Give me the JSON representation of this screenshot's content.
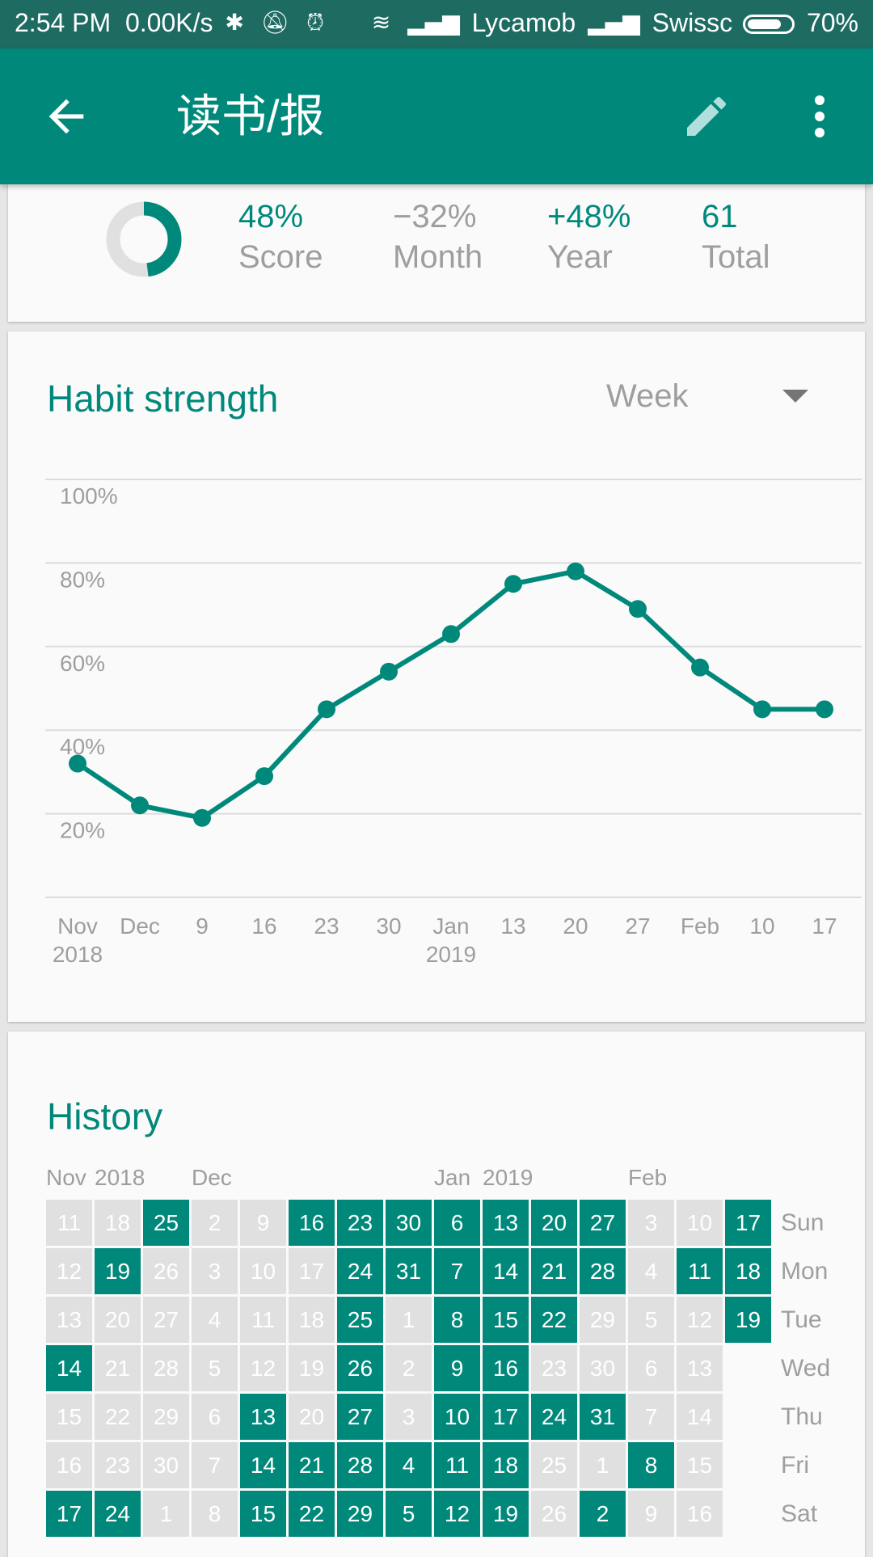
{
  "status_bar": {
    "time": "2:54 PM",
    "speed": "0.00K/s",
    "carrier1": "Lycamob",
    "carrier2": "Swissc",
    "battery": "70%"
  },
  "app_bar": {
    "title": "读书/报",
    "back_icon": "arrow-back-icon",
    "edit_icon": "pencil-icon",
    "more_icon": "more-vert-icon"
  },
  "overview": {
    "score_fraction": 0.48,
    "stats": [
      {
        "value": "48%",
        "label": "Score",
        "color": "#00897b"
      },
      {
        "value": "−32%",
        "label": "Month",
        "color": "#9e9e9e"
      },
      {
        "value": "+48%",
        "label": "Year",
        "color": "#00897b"
      },
      {
        "value": "61",
        "label": "Total",
        "color": "#00897b"
      }
    ]
  },
  "strength": {
    "title": "Habit strength",
    "period": "Week"
  },
  "chart_data": {
    "type": "line",
    "x": [
      "Nov 2018",
      "Dec",
      "9",
      "16",
      "23",
      "30",
      "Jan 2019",
      "13",
      "20",
      "27",
      "Feb",
      "10",
      "17"
    ],
    "x_label_lines": [
      [
        "Nov",
        "2018"
      ],
      [
        "Dec",
        ""
      ],
      [
        "9",
        ""
      ],
      [
        "16",
        ""
      ],
      [
        "23",
        ""
      ],
      [
        "30",
        ""
      ],
      [
        "Jan",
        "2019"
      ],
      [
        "13",
        ""
      ],
      [
        "20",
        ""
      ],
      [
        "27",
        ""
      ],
      [
        "Feb",
        ""
      ],
      [
        "10",
        ""
      ],
      [
        "17",
        ""
      ]
    ],
    "values": [
      32,
      22,
      19,
      29,
      45,
      54,
      63,
      75,
      78,
      69,
      55,
      45,
      45
    ],
    "yticks": [
      "100%",
      "80%",
      "60%",
      "40%",
      "20%"
    ],
    "ylim": [
      0,
      100
    ],
    "grid": true,
    "color": "#00897b"
  },
  "history": {
    "title": "History",
    "months": [
      {
        "label": "Nov",
        "col": 0
      },
      {
        "label": "2018",
        "col": 1
      },
      {
        "label": "Dec",
        "col": 3
      },
      {
        "label": "Jan",
        "col": 8
      },
      {
        "label": "2019",
        "col": 9
      },
      {
        "label": "Feb",
        "col": 12
      }
    ],
    "weekdays": [
      "Sun",
      "Mon",
      "Tue",
      "Wed",
      "Thu",
      "Fri",
      "Sat"
    ],
    "columns": [
      [
        [
          "11",
          0
        ],
        [
          "12",
          0
        ],
        [
          "13",
          0
        ],
        [
          "14",
          1
        ],
        [
          "15",
          0
        ],
        [
          "16",
          0
        ],
        [
          "17",
          1
        ]
      ],
      [
        [
          "18",
          0
        ],
        [
          "19",
          1
        ],
        [
          "20",
          0
        ],
        [
          "21",
          0
        ],
        [
          "22",
          0
        ],
        [
          "23",
          0
        ],
        [
          "24",
          1
        ]
      ],
      [
        [
          "25",
          1
        ],
        [
          "26",
          0
        ],
        [
          "27",
          0
        ],
        [
          "28",
          0
        ],
        [
          "29",
          0
        ],
        [
          "30",
          0
        ],
        [
          "1",
          0
        ]
      ],
      [
        [
          "2",
          0
        ],
        [
          "3",
          0
        ],
        [
          "4",
          0
        ],
        [
          "5",
          0
        ],
        [
          "6",
          0
        ],
        [
          "7",
          0
        ],
        [
          "8",
          0
        ]
      ],
      [
        [
          "9",
          0
        ],
        [
          "10",
          0
        ],
        [
          "11",
          0
        ],
        [
          "12",
          0
        ],
        [
          "13",
          1
        ],
        [
          "14",
          1
        ],
        [
          "15",
          1
        ]
      ],
      [
        [
          "16",
          1
        ],
        [
          "17",
          0
        ],
        [
          "18",
          0
        ],
        [
          "19",
          0
        ],
        [
          "20",
          0
        ],
        [
          "21",
          1
        ],
        [
          "22",
          1
        ]
      ],
      [
        [
          "23",
          1
        ],
        [
          "24",
          1
        ],
        [
          "25",
          1
        ],
        [
          "26",
          1
        ],
        [
          "27",
          1
        ],
        [
          "28",
          1
        ],
        [
          "29",
          1
        ]
      ],
      [
        [
          "30",
          1
        ],
        [
          "31",
          1
        ],
        [
          "1",
          0
        ],
        [
          "2",
          0
        ],
        [
          "3",
          0
        ],
        [
          "4",
          1
        ],
        [
          "5",
          1
        ]
      ],
      [
        [
          "6",
          1
        ],
        [
          "7",
          1
        ],
        [
          "8",
          1
        ],
        [
          "9",
          1
        ],
        [
          "10",
          1
        ],
        [
          "11",
          1
        ],
        [
          "12",
          1
        ]
      ],
      [
        [
          "13",
          1
        ],
        [
          "14",
          1
        ],
        [
          "15",
          1
        ],
        [
          "16",
          1
        ],
        [
          "17",
          1
        ],
        [
          "18",
          1
        ],
        [
          "19",
          1
        ]
      ],
      [
        [
          "20",
          1
        ],
        [
          "21",
          1
        ],
        [
          "22",
          1
        ],
        [
          "23",
          0
        ],
        [
          "24",
          1
        ],
        [
          "25",
          0
        ],
        [
          "26",
          0
        ]
      ],
      [
        [
          "27",
          1
        ],
        [
          "28",
          1
        ],
        [
          "29",
          0
        ],
        [
          "30",
          0
        ],
        [
          "31",
          1
        ],
        [
          "1",
          0
        ],
        [
          "2",
          1
        ]
      ],
      [
        [
          "3",
          0
        ],
        [
          "4",
          0
        ],
        [
          "5",
          0
        ],
        [
          "6",
          0
        ],
        [
          "7",
          0
        ],
        [
          "8",
          1
        ],
        [
          "9",
          0
        ]
      ],
      [
        [
          "10",
          0
        ],
        [
          "11",
          1
        ],
        [
          "12",
          0
        ],
        [
          "13",
          0
        ],
        [
          "14",
          0
        ],
        [
          "15",
          0
        ],
        [
          "16",
          0
        ]
      ],
      [
        [
          "17",
          1
        ],
        [
          "18",
          1
        ],
        [
          "19",
          1
        ]
      ]
    ]
  }
}
